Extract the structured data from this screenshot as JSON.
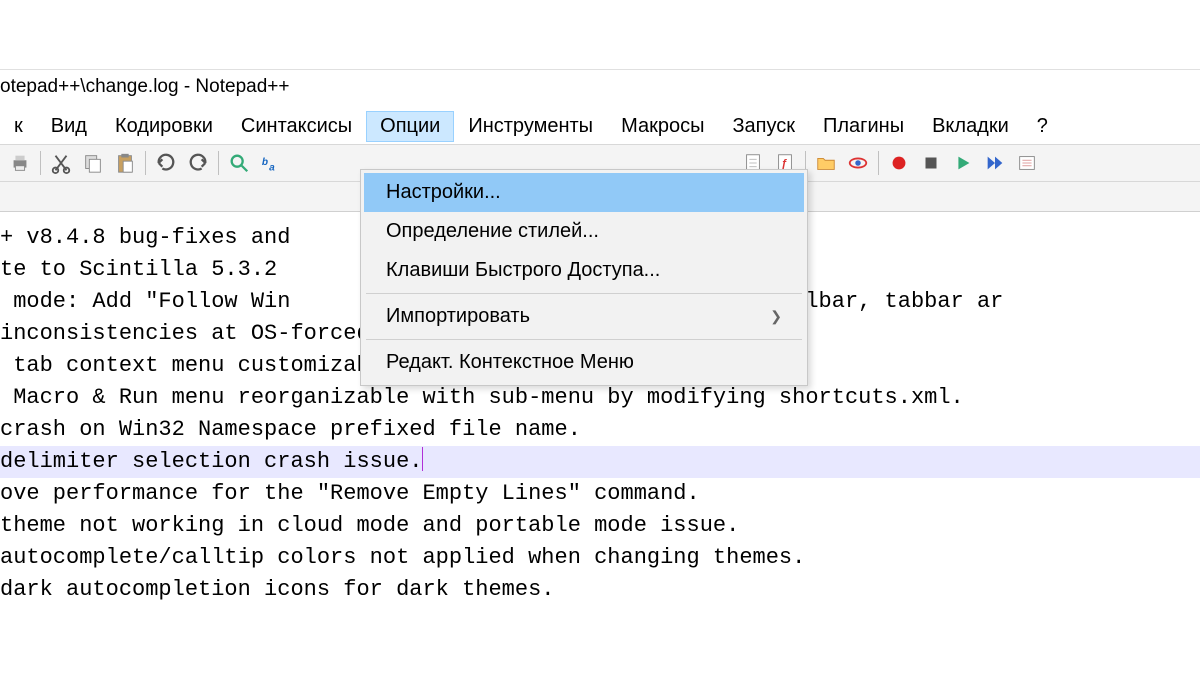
{
  "title": "otepad++\\change.log - Notepad++",
  "menu": {
    "items": [
      "к",
      "Вид",
      "Кодировки",
      "Синтаксисы",
      "Опции",
      "Инструменты",
      "Макросы",
      "Запуск",
      "Плагины",
      "Вкладки",
      "?"
    ],
    "open_index": 4
  },
  "dropdown": {
    "items": [
      {
        "label": "Настройки...",
        "highlight": true
      },
      {
        "label": "Определение стилей..."
      },
      {
        "label": "Клавиши Быстрого Доступа..."
      },
      {
        "sep": true
      },
      {
        "label": "Импортировать",
        "submenu": true
      },
      {
        "sep": true
      },
      {
        "label": "Редакт. Контекстное Меню"
      }
    ]
  },
  "toolbar": {
    "icons_left": [
      "print",
      "cut",
      "copy",
      "paste",
      "undo",
      "redo",
      "find",
      "word-wrap"
    ],
    "icons_right": [
      "doc",
      "doc-func",
      "folder",
      "eye",
      "record",
      "stop",
      "play",
      "fast-forward",
      "list"
    ]
  },
  "editor": {
    "lines": [
      "+ v8.4.8 bug-fixes and",
      "",
      "te to Scintilla 5.3.2 ",
      " mode: Add \"Follow Win                              , and toolbar, tabbar ar",
      "inconsistencies at OS-forced Notepad++ v8.4.7 exit.",
      " tab context menu customizable.",
      " Macro & Run menu reorganizable with sub-menu by modifying shortcuts.xml.",
      "crash on Win32 Namespace prefixed file name.",
      "delimiter selection crash issue.",
      "ove performance for the \"Remove Empty Lines\" command.",
      "theme not working in cloud mode and portable mode issue.",
      "autocomplete/calltip colors not applied when changing themes.",
      "dark autocompletion icons for dark themes."
    ],
    "selected_line_index": 8
  }
}
